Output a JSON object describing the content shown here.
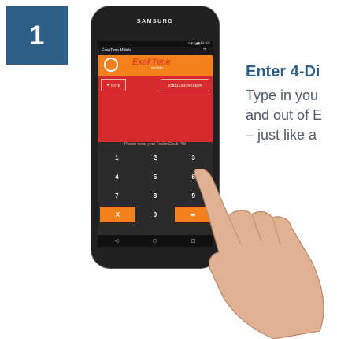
{
  "step": {
    "number": "1"
  },
  "info": {
    "title": "Enter 4-Di",
    "lines": [
      "Type in you",
      "and out of E",
      "– just like a"
    ]
  },
  "phone": {
    "brand": "SAMSUNG",
    "status": "▾◉▿◪▮12:56",
    "app_title": "ExakTime Mobile",
    "menu_icon": "?",
    "logo_text": "ExakTime",
    "logo_sub": "mobile",
    "rate_label": "RATE",
    "reader_label": "JOBCLOCK READER",
    "pin_prompt": "Please enter your PocketClock PIN",
    "keys": [
      "1",
      "2",
      "3",
      "4",
      "5",
      "6",
      "7",
      "8",
      "9",
      "X",
      "0",
      "➡"
    ],
    "nav": [
      "◁",
      "○",
      "□"
    ]
  },
  "colors": {
    "brand_blue": "#2f5f86",
    "app_red": "#d62a2c",
    "app_orange": "#f2801b"
  }
}
